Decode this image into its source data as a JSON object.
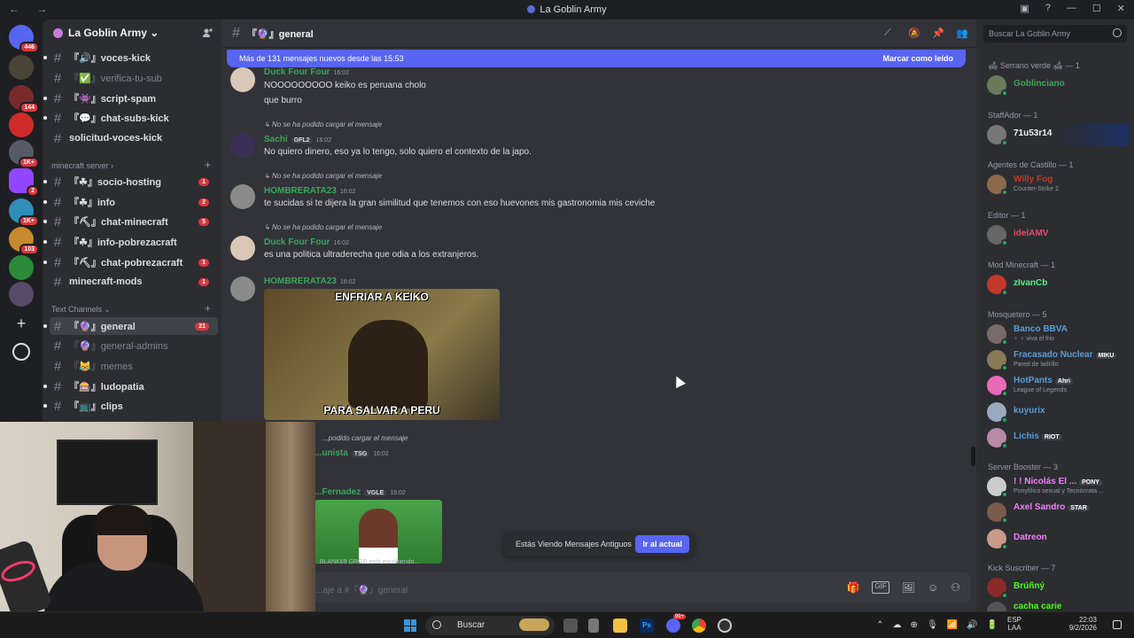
{
  "window": {
    "title": "La Goblin Army",
    "nav": "← →",
    "controls": [
      "▣",
      "?",
      "—",
      "☐",
      "✕"
    ]
  },
  "servers": [
    {
      "badge": "446"
    },
    {
      "badge": ""
    },
    {
      "badge": "144"
    },
    {
      "badge": ""
    },
    {
      "badge": "1K+"
    },
    {
      "badge": "2"
    },
    {
      "badge": "1K+"
    },
    {
      "badge": "103"
    },
    {
      "badge": ""
    },
    {
      "badge": ""
    }
  ],
  "sidebar": {
    "guild_name": "La Goblin Army ⌄",
    "channels_top": [
      {
        "label": "『🔊』voces-kick",
        "muted": false
      },
      {
        "label": "『✅』verifica-tu-sub",
        "muted": true
      },
      {
        "label": "『👾』script-spam",
        "muted": false
      },
      {
        "label": "『💬』chat-subs-kick",
        "muted": false
      },
      {
        "label": "solicitud-voces-kick",
        "muted": false
      }
    ],
    "category_mc": "minecraft server ›",
    "channels_mc": [
      {
        "label": "『☘』socio-hosting",
        "count": "1"
      },
      {
        "label": "『☘』info",
        "count": "2"
      },
      {
        "label": "『⛏』chat-minecraft",
        "count": "5"
      },
      {
        "label": "『☘』info-pobrezacraft",
        "count": ""
      },
      {
        "label": "『⛏』chat-pobrezacraft",
        "count": "1"
      },
      {
        "label": "minecraft-mods",
        "count": "1"
      }
    ],
    "category_text": "Text Channels ⌄",
    "channels_text": [
      {
        "label": "『🔮』general",
        "count": "21",
        "muted": false
      },
      {
        "label": "『🔮』general-admins",
        "count": "",
        "muted": true
      },
      {
        "label": "『😹』memes",
        "count": "",
        "muted": true
      },
      {
        "label": "『🎰』ludopatia",
        "count": "",
        "muted": false
      },
      {
        "label": "『📺』clips",
        "count": "",
        "muted": false
      }
    ]
  },
  "chat": {
    "channel": "『🔮』general",
    "new_bar": "Más de 131 mensajes nuevos desde las 15:53",
    "mark_read": "Marcar como leído",
    "messages": [
      {
        "author": "Duck Four Four",
        "color": "#3ba55c",
        "time": "16:02",
        "tag": "",
        "reply": "",
        "lines": [
          "NOOOOOOOOO keiko es peruana cholo",
          "que burro"
        ]
      },
      {
        "author": "Sachi",
        "color": "#3ba55c",
        "time": "16:02",
        "tag": "GFL2",
        "reply": "No se ha podido cargar el mensaje",
        "lines": [
          "No quiero dinero, eso ya lo tengo, solo quiero el contexto de la japo."
        ]
      },
      {
        "author": "HOMBRERATA23",
        "color": "#3ba55c",
        "time": "16:02",
        "tag": "",
        "reply": "No se ha podido cargar el mensaje",
        "lines": [
          "te sucidas si te dijera la gran similitud que tenemos con eso huevones mis gastronomia mis ceviche"
        ]
      },
      {
        "author": "Duck Four Four",
        "color": "#3ba55c",
        "time": "16:02",
        "tag": "",
        "reply": "No se ha podido cargar el mensaje",
        "lines": [
          "es una politica ultraderecha que odia a los extranjeros."
        ]
      },
      {
        "author": "HOMBRERATA23",
        "color": "#3ba55c",
        "time": "16:02",
        "tag": "",
        "reply": "",
        "lines": []
      },
      {
        "author": "...unista",
        "color": "#3ba55c",
        "time": "16:02",
        "tag": "TSG",
        "reply": "...podido cargar el mensaje",
        "lines": []
      },
      {
        "author": "...Fernadez",
        "color": "#3ba55c",
        "time": "16:02",
        "tag": "VGLE",
        "reply": "",
        "lines": []
      }
    ],
    "gif_top": "ENFRIAR A KEIKO",
    "gif_bottom": "PARA SALVAR A PERU",
    "typing": "...BLANK69 GRGR está escribiendo...",
    "old_notice": "Estás Viendo Mensajes Antiguos",
    "jump_button": "Ir al actual",
    "composer_placeholder": "...aje a #『🔮』general",
    "header_tools": [
      "⟋",
      "🔕",
      "📌",
      "👥"
    ],
    "composer_tools": [
      "🎁",
      "GIF",
      "🖼",
      "☺",
      "⚇"
    ]
  },
  "members": {
    "search_placeholder": "Buscar La Goblin Army",
    "roles": [
      {
        "label": "🛋 Serrano verde 🛋 — 1",
        "members": [
          {
            "name": "Goblinciano",
            "color": "#3ba55c",
            "sub": "",
            "tag": ""
          }
        ]
      },
      {
        "label": "StaffAdor — 1",
        "members": [
          {
            "name": "71u53r14",
            "color": "#f2f3f5",
            "sub": "",
            "tag": "",
            "hl": true
          }
        ]
      },
      {
        "label": "Agentes de Castillo — 1",
        "members": [
          {
            "name": "Willy Fog",
            "color": "#c0392b",
            "sub": "Counter-Strike 2",
            "tag": ""
          }
        ]
      },
      {
        "label": "Editor — 1",
        "members": [
          {
            "name": "idelAMV",
            "color": "#e84a63",
            "sub": "",
            "tag": ""
          }
        ]
      },
      {
        "label": "Mod Minecraft — 1",
        "members": [
          {
            "name": "zIvanCb",
            "color": "#57f287",
            "sub": "",
            "tag": ""
          }
        ]
      },
      {
        "label": "Mosquetero — 5",
        "members": [
          {
            "name": "Banco BBVA",
            "color": "#5b9bd5",
            "sub": "♀ ♀ viva el frio",
            "tag": ""
          },
          {
            "name": "Fracasado Nuclear",
            "color": "#5b9bd5",
            "sub": "Pared de ladrillo",
            "tag": "MIKU"
          },
          {
            "name": "HotPants",
            "color": "#5b9bd5",
            "sub": "League of Legends",
            "tag": "Ahri"
          },
          {
            "name": "kuyurix",
            "color": "#5b9bd5",
            "sub": "",
            "tag": ""
          },
          {
            "name": "Lichis",
            "color": "#5b9bd5",
            "sub": "",
            "tag": "RIOT"
          }
        ]
      },
      {
        "label": "Server Booster — 3",
        "members": [
          {
            "name": "! ! Nicolás El ...",
            "color": "#f47fff",
            "sub": "Ponyfílico sexual y Tecnócrata ...",
            "tag": "PONY"
          },
          {
            "name": "Axel Sandro",
            "color": "#f47fff",
            "sub": "",
            "tag": "STAR"
          },
          {
            "name": "Datreon",
            "color": "#f47fff",
            "sub": "",
            "tag": ""
          }
        ]
      },
      {
        "label": "Kick Suscriber — 7",
        "members": [
          {
            "name": "Brúñný",
            "color": "#53fc18",
            "sub": "",
            "tag": ""
          },
          {
            "name": "cacha carie",
            "color": "#53fc18",
            "sub": "",
            "tag": ""
          }
        ]
      }
    ]
  },
  "taskbar": {
    "search_label": "Buscar",
    "lang": "ESP\nLAA",
    "time": "22:03",
    "date": "9/2/2026",
    "discord_badge": "99+",
    "tray_icons": [
      "⌃",
      "☁",
      "⊕",
      "🎙",
      "📶",
      "🔊",
      "🔋"
    ]
  },
  "colors": {
    "accent": "#5865f2",
    "online": "#23a55a",
    "badge": "#da373c"
  }
}
